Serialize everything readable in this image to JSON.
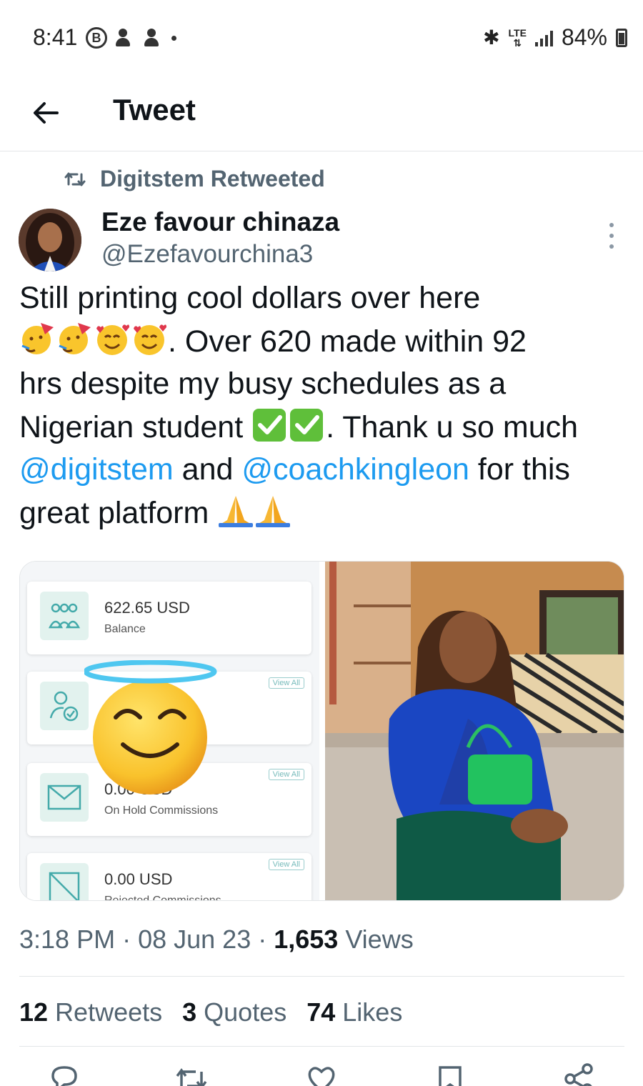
{
  "status_bar": {
    "time": "8:41",
    "b_icon_letter": "B",
    "network": "LTE",
    "battery": "84%"
  },
  "header": {
    "title": "Tweet"
  },
  "retweet_context": {
    "label": "Digitstem Retweeted"
  },
  "author": {
    "name": "Eze favour chinaza",
    "handle": "@Ezefavourchina3"
  },
  "tweet": {
    "line1": "Still printing cool dollars over here",
    "part2": ". Over 620 made within 92",
    "line3": "hrs despite my busy schedules as a",
    "line4a": "Nigerian student ",
    "line4b": ". Thank u so much",
    "mention1": "@digitstem",
    "and_text": " and ",
    "mention2": "@coachkingleon",
    "line5b": " for this",
    "line6": "great platform "
  },
  "media": {
    "cards": [
      {
        "value": "622.65 USD",
        "label": "Balance",
        "view_all": ""
      },
      {
        "value": "",
        "label": "",
        "view_all": "View All"
      },
      {
        "value": "0.00 USD",
        "label": "On Hold Commissions",
        "view_all": "View All"
      },
      {
        "value": "0.00 USD",
        "label": "Rejected Commissions",
        "view_all": "View All"
      }
    ]
  },
  "meta": {
    "time": "3:18 PM",
    "sep1": " · ",
    "date": "08 Jun 23",
    "sep2": " · ",
    "views_count": "1,653",
    "views_label": " Views"
  },
  "stats": {
    "retweets_count": "12",
    "retweets_label": " Retweets",
    "quotes_count": "3",
    "quotes_label": " Quotes",
    "likes_count": "74",
    "likes_label": " Likes"
  },
  "colors": {
    "link": "#1d9bf0",
    "secondary_text": "#536471",
    "primary_text": "#0f1419"
  }
}
